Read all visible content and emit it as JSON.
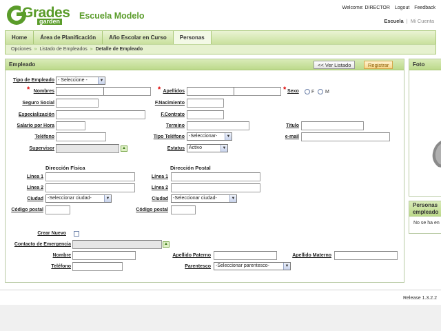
{
  "header": {
    "logo_word": "Grades",
    "logo_sub": "garden",
    "school_name": "Escuela Modelo",
    "welcome": "Welcome: DIRECTOR",
    "logout": "Logout",
    "feedback": "Feedback",
    "sub_active": "Escuela",
    "sub_sep": "|",
    "sub_inactive": "Mi Cuenta"
  },
  "nav": {
    "tabs": [
      "Home",
      "Área de Planificación",
      "Año Escolar en Curso",
      "Personas"
    ],
    "active_index": 3
  },
  "breadcrumb": [
    "Opciones",
    "Listado de Empleados",
    "Detalle de Empleado"
  ],
  "panel": {
    "title": "Empleado",
    "list_button": "<< Ver Listado",
    "register_button": "Registrar"
  },
  "form": {
    "tipo_empleado": "Tipo de Empleado",
    "tipo_empleado_value": "- Seleccione -",
    "nombres": "Nombres",
    "apellidos": "Apellidos",
    "sexo": "Sexo",
    "sexo_f": "F",
    "sexo_m": "M",
    "seguro_social": "Seguro Social",
    "f_nacimiento": "F.Nacimiento",
    "especializacion": "Especialización",
    "f_contrato": "F.Contrato",
    "salario": "Salario por Hora",
    "termino": "Termino",
    "titulo": "Titulo",
    "telefono": "Teléfono",
    "tipo_telefono": "Tipo Teléfono",
    "tipo_telefono_value": "-Seleccionar-",
    "email": "e-mail",
    "supervisor": "Supervisor",
    "estatus": "Estatus",
    "estatus_value": "Activo",
    "up_symbol": "▲",
    "dropdown_symbol": "▼",
    "required_mark": "*"
  },
  "address": {
    "fisica_title": "Dirección Física",
    "postal_title": "Dirección Postal",
    "linea1": "Línea 1",
    "linea2": "Línea 2",
    "ciudad": "Ciudad",
    "ciudad_value": "-Seleccionar ciudad-",
    "codigo_postal": "Código postal"
  },
  "emergency": {
    "crear_nuevo": "Crear Nuevo",
    "contacto": "Contacto de Emergencia",
    "nombre": "Nombre",
    "apellido_paterno": "Apellido Paterno",
    "apellido_materno": "Apellido Materno",
    "telefono": "Teléfono",
    "parentesco": "Parentesco",
    "parentesco_value": "-Seleccionar parentesco-"
  },
  "side": {
    "foto_title": "Foto",
    "personas_title": "Personas empleado",
    "personas_msg": "No se ha en"
  },
  "footer": {
    "release": "Release 1.3.2.2"
  },
  "colors": {
    "brand_green": "#5a9c2a",
    "nav_bg": "#c9e09d",
    "required": "#dd0000"
  }
}
